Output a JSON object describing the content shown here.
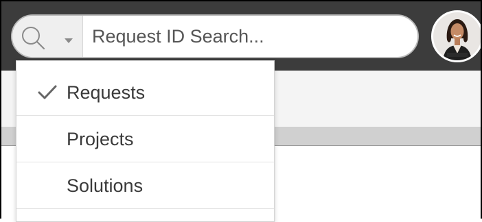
{
  "search": {
    "placeholder": "Request ID Search...",
    "scope_icon": "search-icon",
    "caret_icon": "caret-down-icon"
  },
  "user": {
    "avatar_icon": "user-avatar"
  },
  "dropdown": {
    "selected_index": 0,
    "items": [
      {
        "label": "Requests",
        "selected": true,
        "icon": "check-icon"
      },
      {
        "label": "Projects",
        "selected": false
      },
      {
        "label": "Solutions",
        "selected": false
      }
    ]
  },
  "colors": {
    "topbar": "#3c3c3c",
    "dropdown_text": "#3a3a3a",
    "check": "#666666"
  }
}
